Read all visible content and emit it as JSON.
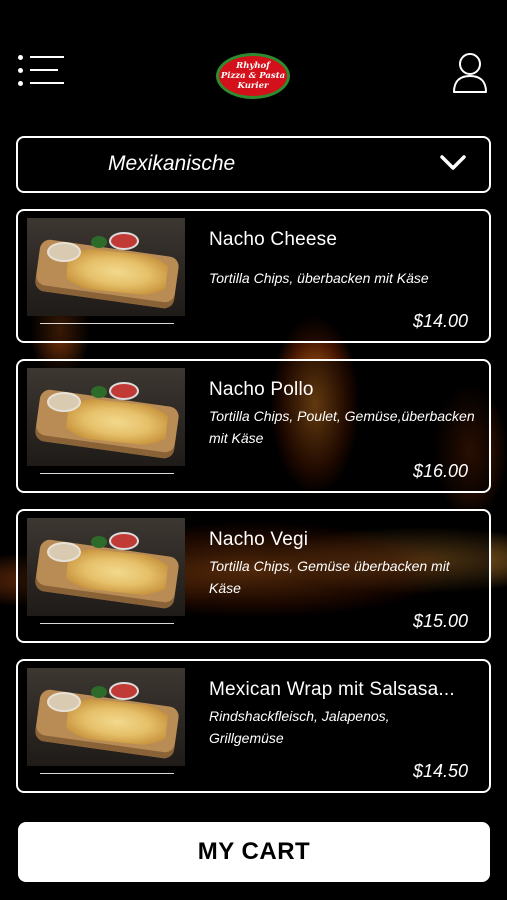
{
  "header": {
    "logo_text": [
      "Rhyhof",
      "Pizza & Pasta",
      "Kurier"
    ],
    "menu_icon": "hamburger-menu-icon",
    "user_icon": "user-profile-icon"
  },
  "category": {
    "selected": "Mexikanische",
    "icon": "chevron-down-icon"
  },
  "items": [
    {
      "name": "Nacho Cheese",
      "description": "Tortilla Chips, überbacken mit Käse",
      "price": "$14.00"
    },
    {
      "name": "Nacho Pollo",
      "description": "Tortilla Chips, Poulet, Gemüse,überbacken mit Käse",
      "price": "$16.00"
    },
    {
      "name": "Nacho Vegi",
      "description": "Tortilla Chips, Gemüse überbacken mit Käse",
      "price": "$15.00"
    },
    {
      "name": "Mexican Wrap mit Salsasa...",
      "description": "Rindshackfleisch, Jalapenos, Grillgemüse",
      "price": "$14.50"
    }
  ],
  "cart": {
    "label": "MY CART"
  },
  "colors": {
    "background": "#000000",
    "text": "#ffffff",
    "logo_red": "#d4101b",
    "logo_green": "#2e8b2e"
  }
}
